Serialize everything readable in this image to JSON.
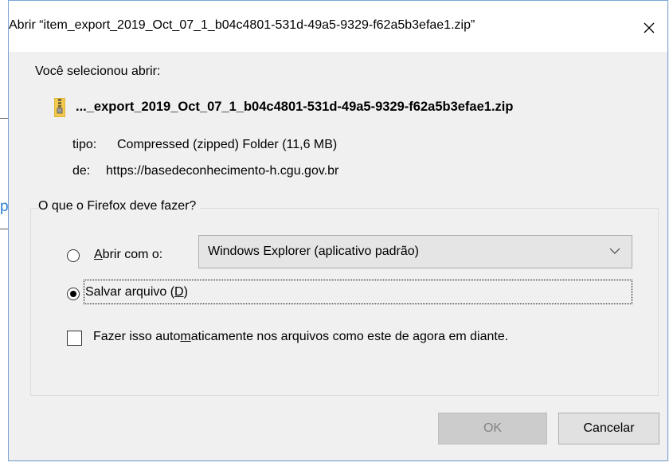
{
  "window": {
    "title": "Abrir “item_export_2019_Oct_07_1_b04c4801-531d-49a5-9329-f62a5b3efae1.zip”",
    "close_glyph": "✕"
  },
  "info": {
    "prompt": "Você selecionou abrir:",
    "file_name": "..._export_2019_Oct_07_1_b04c4801-531d-49a5-9329-f62a5b3efae1.zip",
    "type_label": "tipo:",
    "type_value": "Compressed (zipped) Folder (11,6 MB)",
    "from_label": "de:",
    "from_value": "https://basedeconhecimento-h.cgu.gov.br"
  },
  "action_group": {
    "legend": "O que o Firefox deve fazer?",
    "open_with": {
      "label_prefix": "",
      "label_accel": "A",
      "label_rest": "brir com o:",
      "selected": false,
      "app": "Windows Explorer (aplicativo padrão)"
    },
    "save_file": {
      "label_prefix": "Salvar arquivo (",
      "label_accel": "D",
      "label_rest": ")",
      "selected": true
    },
    "remember": {
      "label_prefix": "Fazer isso auto",
      "label_accel": "m",
      "label_rest": "aticamente nos arquivos como este de agora em diante.",
      "checked": false
    }
  },
  "buttons": {
    "ok": "OK",
    "cancel": "Cancelar"
  },
  "colors": {
    "dialog_bg": "#f0f0f0",
    "border_accent": "#7aa7d8",
    "disabled_text": "#838383"
  },
  "background": {
    "partial_glyph": "p"
  }
}
